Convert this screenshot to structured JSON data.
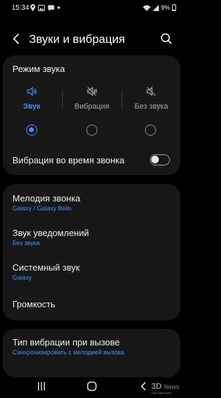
{
  "status_bar": {
    "time": "15:34",
    "battery": "9%"
  },
  "header": {
    "title": "Звуки и вибрация"
  },
  "sound_mode": {
    "label": "Режим звука",
    "options": [
      {
        "label": "Звук",
        "icon": "speaker-icon",
        "selected": true
      },
      {
        "label": "Вибрация",
        "icon": "vibrate-icon",
        "selected": false
      },
      {
        "label": "Без звука",
        "icon": "mute-icon",
        "selected": false
      }
    ]
  },
  "vibrate_while_ringing": {
    "label": "Вибрация во время звонка",
    "enabled": false
  },
  "settings": [
    {
      "title": "Мелодия звонка",
      "subtitle": "Galaxy / Galaxy Bells"
    },
    {
      "title": "Звук уведомлений",
      "subtitle": "Без звука"
    },
    {
      "title": "Системный звук",
      "subtitle": "Galaxy"
    },
    {
      "title": "Громкость",
      "subtitle": ""
    }
  ],
  "vibration": [
    {
      "title": "Тип вибрации при вызове",
      "subtitle": "Синхронизировать с мелодией вызова"
    }
  ],
  "colors": {
    "accent": "#3e91ff",
    "card": "#171717",
    "background": "#000000"
  }
}
